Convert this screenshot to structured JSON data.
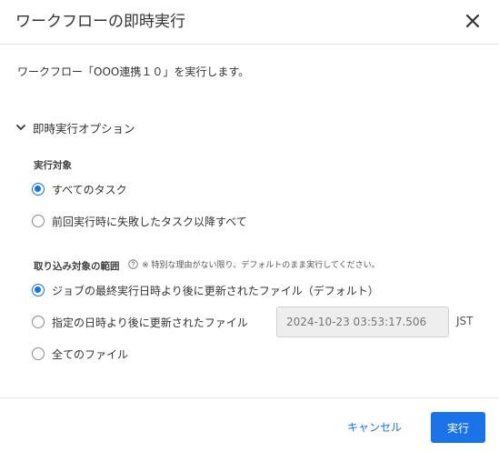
{
  "dialog": {
    "title": "ワークフローの即時実行",
    "description": "ワークフロー「OOO連携１０」を実行します。"
  },
  "options_section": {
    "label": "即時実行オプション",
    "expanded": true
  },
  "target": {
    "label": "実行対象",
    "options": [
      {
        "label": "すべてのタスク",
        "checked": true
      },
      {
        "label": "前回実行時に失敗したタスク以降すべて",
        "checked": false
      }
    ]
  },
  "scope": {
    "label": "取り込み対象の範囲",
    "hint": "※ 特別な理由がない限り、デフォルトのまま実行してください。",
    "options": [
      {
        "label": "ジョブの最終実行日時より後に更新されたファイル（デフォルト）",
        "checked": true
      },
      {
        "label": "指定の日時より後に更新されたファイル",
        "checked": false
      },
      {
        "label": "全てのファイル",
        "checked": false
      }
    ],
    "datetime_value": "2024-10-23 03:53:17.506",
    "timezone": "JST"
  },
  "footer": {
    "cancel_label": "キャンセル",
    "run_label": "実行"
  },
  "colors": {
    "accent": "#1a73e8",
    "divider": "#e3e3e3",
    "disabled_input_bg": "#eeeeee"
  },
  "icons": {
    "close": "close-icon",
    "section_toggle": "chevron-down-icon",
    "help": "help-circle-icon"
  }
}
